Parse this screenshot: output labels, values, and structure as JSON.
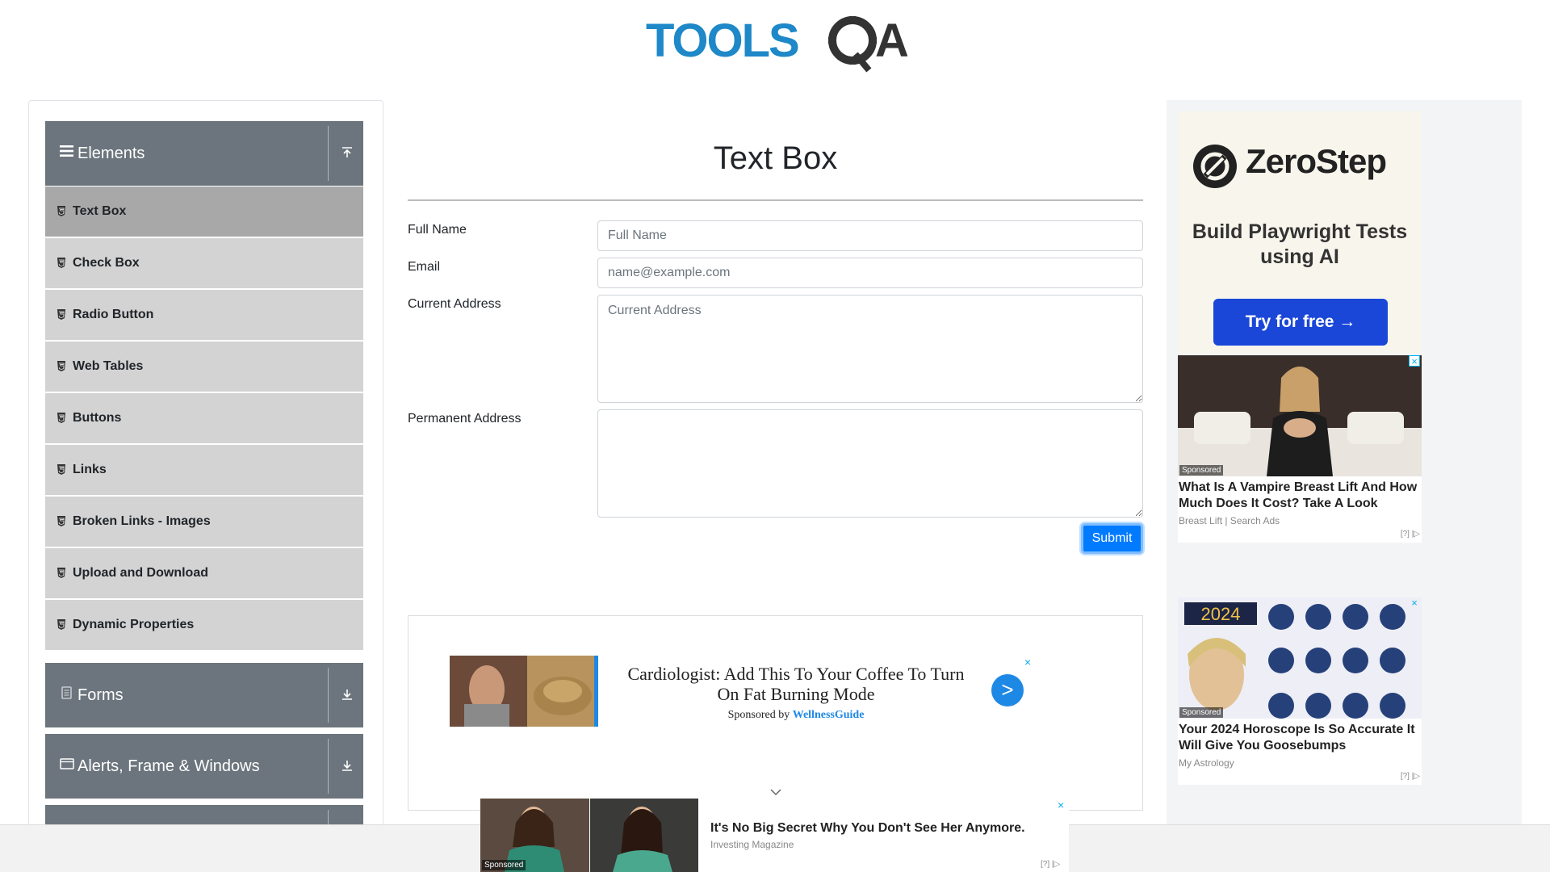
{
  "logo": {
    "text_left": "TOOLS",
    "text_right": "QA"
  },
  "sidebar": {
    "elements_group": {
      "title": "Elements",
      "items": [
        {
          "label": "Text Box"
        },
        {
          "label": "Check Box"
        },
        {
          "label": "Radio Button"
        },
        {
          "label": "Web Tables"
        },
        {
          "label": "Buttons"
        },
        {
          "label": "Links"
        },
        {
          "label": "Broken Links - Images"
        },
        {
          "label": "Upload and Download"
        },
        {
          "label": "Dynamic Properties"
        }
      ]
    },
    "forms_group": {
      "title": "Forms"
    },
    "alerts_group": {
      "title": "Alerts, Frame & Windows"
    }
  },
  "main": {
    "title": "Text Box",
    "full_name": {
      "label": "Full Name",
      "placeholder": "Full Name",
      "value": ""
    },
    "email": {
      "label": "Email",
      "placeholder": "name@example.com",
      "value": ""
    },
    "current_address": {
      "label": "Current Address",
      "placeholder": "Current Address",
      "value": ""
    },
    "permanent_address": {
      "label": "Permanent Address",
      "placeholder": "",
      "value": ""
    },
    "submit_label": "Submit"
  },
  "content_ad": {
    "headline": "Cardiologist: Add This To Your Coffee To Turn On Fat Burning Mode",
    "sponsored_by": "Sponsored by",
    "sponsor": "WellnessGuide",
    "go": ">",
    "close": "×"
  },
  "right_ads": {
    "zerostep": {
      "name": "ZeroStep",
      "tagline": "Build Playwright Tests using AI",
      "cta": "Try for free →"
    },
    "card1": {
      "badge": "Sponsored",
      "headline": "What Is A Vampire Breast Lift And How Much Does It Cost? Take A Look",
      "source": "Breast Lift | Search Ads",
      "adchoice": "[?] |▷",
      "close": "×"
    },
    "card2": {
      "year": "2024",
      "badge": "Sponsored",
      "headline": "Your 2024 Horoscope Is So Accurate It Will Give You Goosebumps",
      "source": "My Astrology",
      "adchoice": "[?] |▷",
      "close": "×"
    }
  },
  "bottom_ad": {
    "badge": "Sponsored",
    "headline": "It's No Big Secret Why You Don't See Her Anymore.",
    "source": "Investing Magazine",
    "adchoice": "[?] |▷",
    "close": "×"
  },
  "colors": {
    "accent": "#007bff",
    "sidebar_header": "#6c757d",
    "menu_item": "#d3d3d3",
    "menu_item_active": "#a8a8a8",
    "logo_blue": "#1e88c8",
    "logo_dark": "#333333"
  }
}
